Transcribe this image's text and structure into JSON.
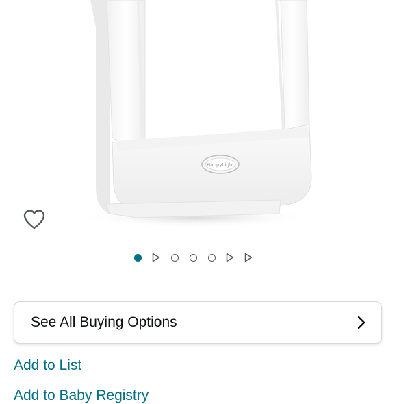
{
  "product": {
    "image_alt": "Light therapy lamp",
    "logo_text": "HappyLight"
  },
  "wishlist": {
    "icon": "heart-outline-icon"
  },
  "carousel": {
    "indicators": [
      {
        "type": "image",
        "active": true
      },
      {
        "type": "video",
        "active": false
      },
      {
        "type": "image",
        "active": false
      },
      {
        "type": "image",
        "active": false
      },
      {
        "type": "image",
        "active": false
      },
      {
        "type": "video",
        "active": false
      },
      {
        "type": "video",
        "active": false
      }
    ],
    "active_color": "#007185"
  },
  "buying_options": {
    "label": "See All Buying Options",
    "icon": "chevron-right-icon"
  },
  "links": {
    "add_to_list": "Add to List",
    "add_to_baby_registry": "Add to Baby Registry"
  },
  "colors": {
    "link": "#007185",
    "text": "#0f1111",
    "border": "#d5d9d9"
  }
}
